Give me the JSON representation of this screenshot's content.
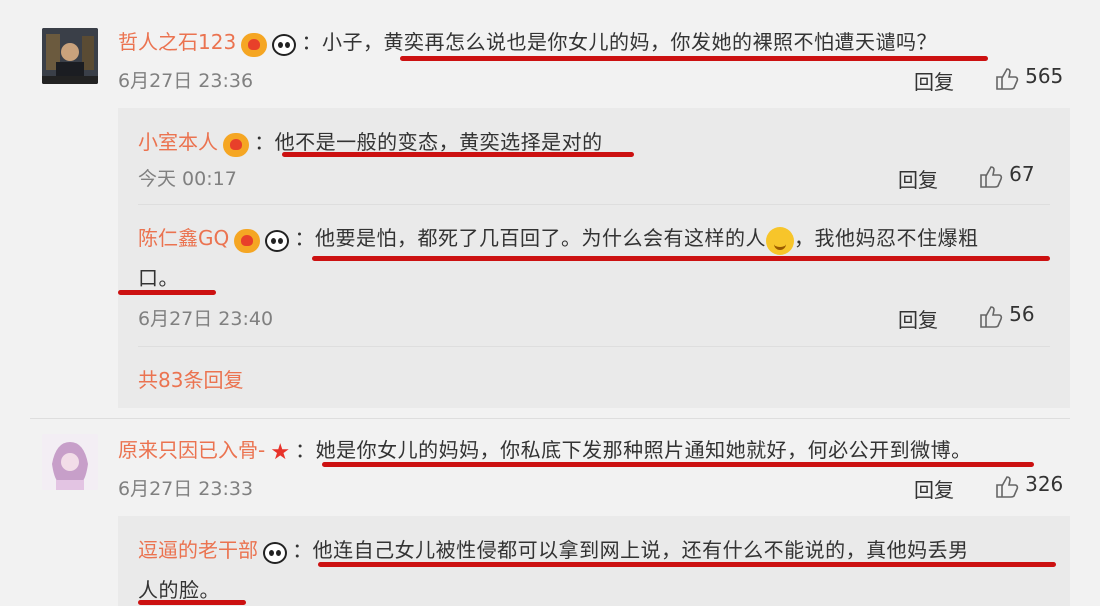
{
  "comments": [
    {
      "user": "哲人之石123",
      "text": "：小子，黄奕再怎么说也是你女儿的妈，你发她的裸照不怕遭天谴吗？",
      "time": "6月27日 23:36",
      "reply_label": "回复",
      "likes": "565"
    },
    {
      "user": "原来只因已入骨-",
      "text": "：她是你女儿的妈妈，你私底下发那种照片通知她就好，何必公开到微博。",
      "time": "6月27日 23:33",
      "reply_label": "回复",
      "likes": "326"
    }
  ],
  "replies": [
    {
      "user": "小室本人",
      "text": "：他不是一般的变态，黄奕选择是对的",
      "time": "今天 00:17",
      "reply_label": "回复",
      "likes": "67"
    },
    {
      "user": "陈仁鑫GQ",
      "text_part1": "：他要是怕，都死了几百回了。为什么会有这样的人",
      "text_part2": "，我他妈忍不住爆粗",
      "text_line2": "口。",
      "time": "6月27日 23:40",
      "reply_label": "回复",
      "likes": "56"
    },
    {
      "user": "逗逼的老干部",
      "text_line1": "：他连自己女儿被性侵都可以拿到网上说，还有什么不能说的，真他妈丢男",
      "text_line2": "人的脸。"
    }
  ],
  "more_replies": "共83条回复",
  "icons": {
    "badge": "vip-crown-icon",
    "panda": "panda-emoji-icon",
    "star": "star-icon",
    "smiley": "smiley-emoji-icon",
    "like": "thumbs-up-icon"
  },
  "colors": {
    "username": "#eb7350",
    "underline": "#cc1111",
    "reply_background": "#eaeaea"
  }
}
